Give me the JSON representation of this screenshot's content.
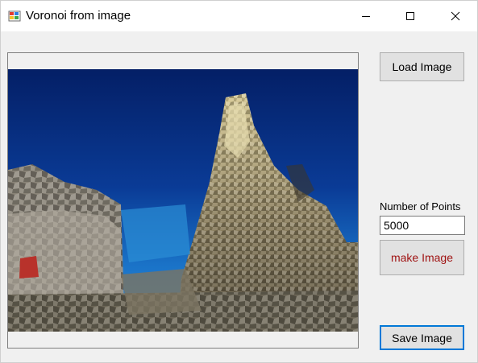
{
  "window": {
    "title": "Voronoi from image",
    "app_icon": "app-window-icon",
    "controls": [
      "minimize-icon",
      "maximize-icon",
      "close-icon"
    ]
  },
  "buttons": {
    "load": "Load Image",
    "make": "make Image",
    "save": "Save Image"
  },
  "points": {
    "label": "Number of Points",
    "value": "5000"
  },
  "colors": {
    "sky_top": "#062a78",
    "sky_bottom": "#1a73c8",
    "tree_light": "#c9bd8a",
    "tree_dark": "#2c2a22",
    "accent_text": "#a01414",
    "focus_border": "#0078d7"
  }
}
